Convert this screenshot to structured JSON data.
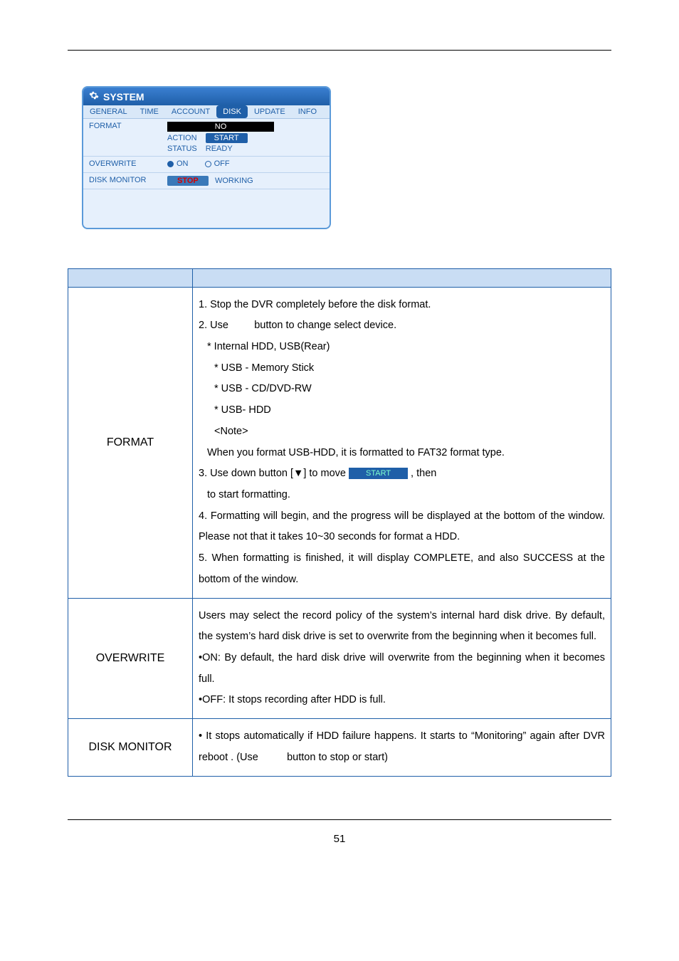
{
  "panel": {
    "title": "SYSTEM",
    "tabs": [
      "GENERAL",
      "TIME",
      "ACCOUNT",
      "DISK",
      "UPDATE",
      "INFO"
    ],
    "active_tab": "DISK",
    "rows": {
      "format": {
        "label": "FORMAT",
        "select_value": "NO",
        "action_label": "ACTION",
        "action_button": "START",
        "status_label": "STATUS",
        "status_value": "READY"
      },
      "overwrite": {
        "label": "OVERWRITE",
        "on": "ON",
        "off": "OFF"
      },
      "diskmonitor": {
        "label": "DISK MONITOR",
        "button": "STOP",
        "status": "WORKING"
      }
    }
  },
  "desc": {
    "format": {
      "label": "FORMAT",
      "l1": "1. Stop the DVR completely before the disk format.",
      "l2a": "2. Use",
      "l2b": "button to change select device.",
      "l3": "* Internal HDD, USB(Rear)",
      "l4": "* USB - Memory Stick",
      "l5": "* USB - CD/DVD-RW",
      "l6": "* USB- HDD",
      "l7": "<Note>",
      "l8": "When you format USB-HDD, it is formatted to FAT32 format type.",
      "l9a": "3. Use down button [▼] to move",
      "l9chip": "START",
      "l9b": ", then",
      "l10": "to start formatting.",
      "l11": "4. Formatting will begin, and the progress will be displayed at the bottom of the window. Please not that it takes 10~30 seconds for format a HDD.",
      "l12": "5. When formatting is finished, it will display COMPLETE, and also SUCCESS at the bottom of the window."
    },
    "overwrite": {
      "label": "OVERWRITE",
      "p1": "Users may select the record policy of the system’s internal hard disk drive. By default, the system’s hard disk drive is set to overwrite from the beginning when it becomes full.",
      "p2": "•ON: By default, the hard disk drive will overwrite from the beginning when it becomes full.",
      "p3": "•OFF: It stops recording after HDD is full."
    },
    "diskmonitor": {
      "label": "DISK MONITOR",
      "p1": "• It stops automatically if HDD failure happens. It starts to “Monitoring” again after DVR reboot . (Use          button to stop or start)"
    }
  },
  "page_number": "51"
}
